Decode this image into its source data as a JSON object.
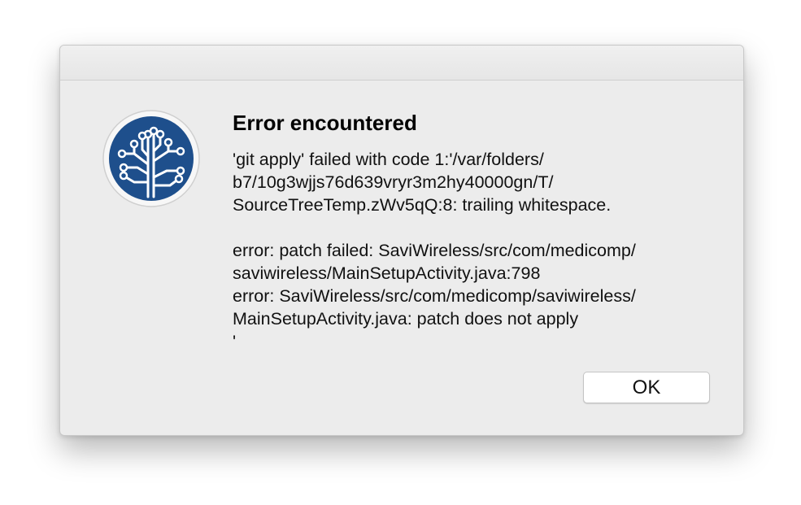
{
  "dialog": {
    "icon": "sourcetree-logo-icon",
    "title": "Error encountered",
    "message": "'git apply' failed with code 1:'/var/folders/\nb7/10g3wjjs76d639vryr3m2hy40000gn/T/\nSourceTreeTemp.zWv5qQ:8: trailing whitespace.\n\nerror: patch failed: SaviWireless/src/com/medicomp/\nsaviwireless/MainSetupActivity.java:798\nerror: SaviWireless/src/com/medicomp/saviwireless/\nMainSetupActivity.java: patch does not apply\n'",
    "ok_label": "OK"
  },
  "colors": {
    "logo_blue": "#1e4f8c",
    "dialog_bg": "#ececec"
  }
}
